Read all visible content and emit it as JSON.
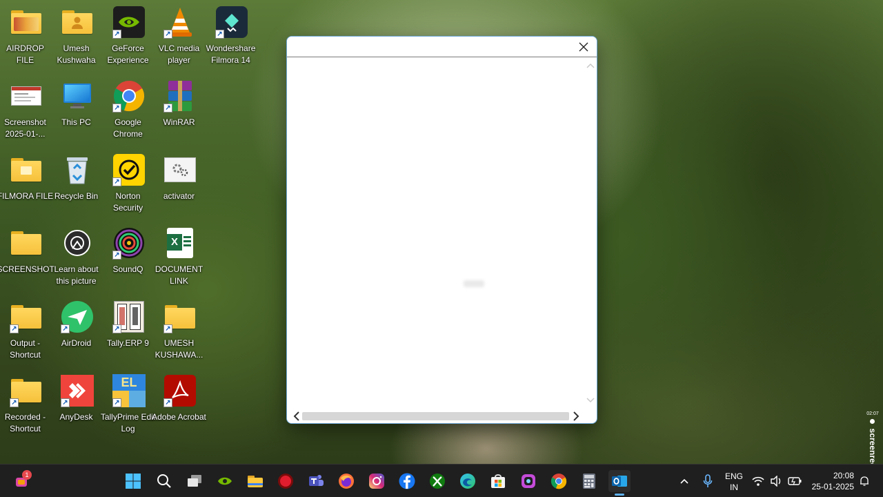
{
  "desktop": {
    "icons": [
      {
        "label": "AIRDROP FILE",
        "icon": "folder-icon"
      },
      {
        "label": "Umesh Kushwaha",
        "icon": "user-folder-icon"
      },
      {
        "label": "GeForce Experience",
        "icon": "nvidia-icon"
      },
      {
        "label": "VLC media player",
        "icon": "vlc-icon"
      },
      {
        "label": "Wondershare Filmora 14",
        "icon": "filmora-icon"
      },
      {
        "label": "Screenshot 2025-01-...",
        "icon": "screenshot-file-icon"
      },
      {
        "label": "This PC",
        "icon": "monitor-icon"
      },
      {
        "label": "Google Chrome",
        "icon": "chrome-icon"
      },
      {
        "label": "WinRAR",
        "icon": "winrar-icon"
      },
      {
        "label": "FILMORA FILE",
        "icon": "folder-icon"
      },
      {
        "label": "Recycle Bin",
        "icon": "recycle-bin-icon"
      },
      {
        "label": "Norton Security",
        "icon": "norton-icon"
      },
      {
        "label": "activator",
        "icon": "gear-file-icon"
      },
      {
        "label": "SCREENSHOT",
        "icon": "folder-icon"
      },
      {
        "label": "Learn about this picture",
        "icon": "camera-icon"
      },
      {
        "label": "SoundQ",
        "icon": "soundq-icon"
      },
      {
        "label": "DOCUMENT LINK",
        "icon": "excel-icon"
      },
      {
        "label": "Output - Shortcut",
        "icon": "folder-icon"
      },
      {
        "label": "AirDroid",
        "icon": "airdroid-icon"
      },
      {
        "label": "Tally.ERP 9",
        "icon": "tally-icon"
      },
      {
        "label": "UMESH KUSHAWA...",
        "icon": "folder-icon"
      },
      {
        "label": "Recorded - Shortcut",
        "icon": "folder-icon"
      },
      {
        "label": "AnyDesk",
        "icon": "anydesk-icon"
      },
      {
        "label": "TallyPrime Edit Log",
        "icon": "tallyprime-icon"
      },
      {
        "label": "Adobe Acrobat",
        "icon": "acrobat-icon"
      }
    ]
  },
  "dialog": {
    "close_glyph": "✕",
    "scroll_up_glyph": "▲",
    "scroll_down_glyph": "▼"
  },
  "taskbar": {
    "apps": [
      "start-icon",
      "search-icon",
      "task-view-icon",
      "nvidia-icon",
      "file-explorer-icon",
      "record-icon",
      "teams-icon",
      "firefox-icon",
      "instagram-icon",
      "facebook-icon",
      "xbox-icon",
      "edge-icon",
      "microsoft-store-icon",
      "copilot-icon",
      "chrome-icon",
      "calculator-icon",
      "outlook-icon"
    ],
    "notification_badge": "1",
    "language_line1": "ENG",
    "language_line2": "IN",
    "time": "20:08",
    "date": "25-01-2025"
  },
  "recorder": {
    "timer": "02:07",
    "brand": "screenrec"
  },
  "colors": {
    "taskbar_bg": "#1f1f1f",
    "dialog_border": "#6aa5d6",
    "active_indicator": "#5fb2f2"
  }
}
